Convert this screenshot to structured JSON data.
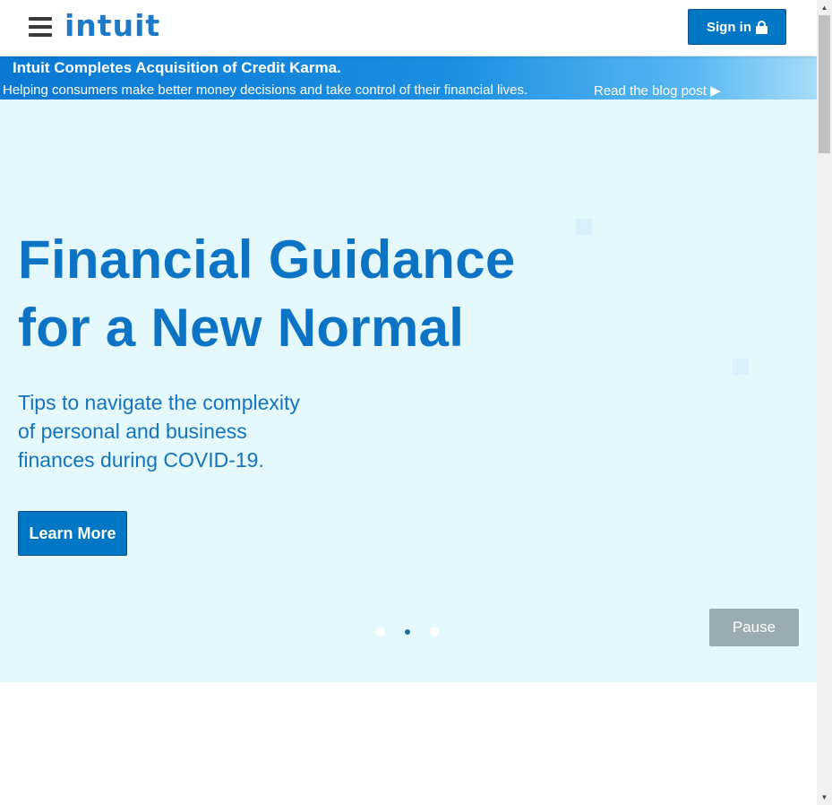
{
  "header": {
    "menu_icon": "hamburger-menu-icon",
    "logo_text": "intuit",
    "signin_label": "Sign in",
    "lock_icon": "lock-icon"
  },
  "banner": {
    "title": "Intuit Completes Acquisition of Credit Karma.",
    "text": "Helping consumers make better money decisions and take control of their financial lives.",
    "link_label": "Read the blog post ▶"
  },
  "hero": {
    "title_line1": "Financial Guidance",
    "title_line2": "for a New Normal",
    "subtitle_line1": "Tips to navigate the complexity",
    "subtitle_line2": "of personal and business",
    "subtitle_line3": "finances during COVID-19.",
    "cta_label": "Learn More",
    "pause_label": "Pause",
    "carousel_active_index": 1,
    "carousel_count": 3
  },
  "scrollbar": {
    "up_arrow": "▲",
    "down_arrow": "▼"
  },
  "colors": {
    "brand_blue": "#0077c5",
    "hero_bg": "#e5f9fd",
    "hero_text": "#0d73c4",
    "pause_bg": "#9aabb2"
  }
}
